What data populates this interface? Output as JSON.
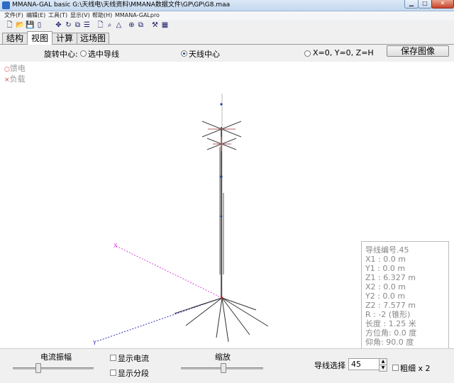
{
  "window": {
    "title": "MMANA-GAL basic G:\\天线电\\天线资料\\MMANA数据文件\\GP\\GP\\G8.maa",
    "min_glyph": "▁",
    "max_glyph": "□",
    "close_glyph": "✕"
  },
  "menu": {
    "items": [
      "文件(F)",
      "编辑(E)",
      "工具(T)",
      "显示(V)",
      "帮助(H)",
      "MMANA-GALpro"
    ]
  },
  "toolbar": {
    "icons": [
      "new-file-icon",
      "open-folder-icon",
      "save-icon",
      "document-icon",
      "move-icon",
      "rotate-icon",
      "graph-icon",
      "lines-icon",
      "page-icon",
      "zoom-icon",
      "triangle-icon",
      "target-icon",
      "copy-icon",
      "tools-icon",
      "calculator-icon"
    ],
    "glyphs": [
      "🗋",
      "📂",
      "💾",
      "▯",
      "✥",
      "↻",
      "⧉",
      "☰",
      "🗋",
      "⌕",
      "△",
      "⊕",
      "⧉",
      "⚒",
      "▦"
    ]
  },
  "tabs": [
    {
      "label": "结构",
      "active": false
    },
    {
      "label": "视图",
      "active": true
    },
    {
      "label": "计算",
      "active": false
    },
    {
      "label": "远场图",
      "active": false
    }
  ],
  "rotation": {
    "label": "旋转中心:",
    "options": [
      {
        "label": "选中导线",
        "selected": false
      },
      {
        "label": "天线中心",
        "selected": true
      },
      {
        "label": "X=0, Y=0, Z=H",
        "selected": false
      }
    ],
    "save_button": "保存图像"
  },
  "legend": {
    "feed_mark": "○",
    "feed": "馈电",
    "load_mark": "×",
    "load": "负载"
  },
  "axes": {
    "x_label": "X",
    "y_label": "Y"
  },
  "wire_info": {
    "lines": [
      "导线编号.45",
      "X1  : 0.0 m",
      "Y1  : 0.0 m",
      "Z1  : 6.327 m",
      "X2  : 0.0 m",
      "Y2  : 0.0 m",
      "Z2  : 7.577 m",
      "R   : -2 (锥形)",
      "长度 : 1.25 米",
      "方位角: 0.0 度",
      "仰角: 90.0 度"
    ]
  },
  "bottom": {
    "current_amplitude": "电流振幅",
    "show_current": "显示电流",
    "show_segments": "显示分段",
    "zoom": "缩放",
    "wire_select_label": "导线选择",
    "wire_select_value": "45",
    "spin_up": "▲",
    "spin_down": "▼",
    "thick_label": "粗细 x 2",
    "current_amplitude_level": 0.3,
    "zoom_level": 0.52
  }
}
